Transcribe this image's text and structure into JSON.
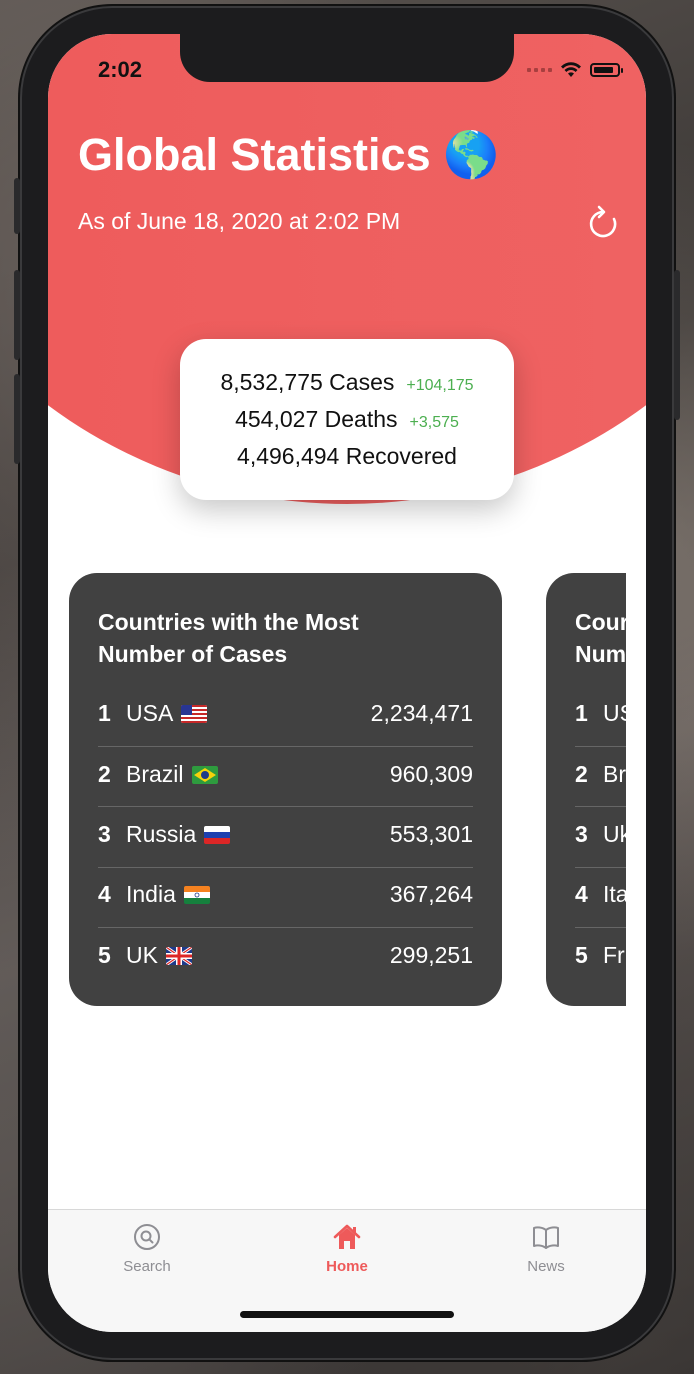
{
  "status_bar": {
    "time": "2:02"
  },
  "header": {
    "title": "Global Statistics 🌎",
    "subtitle": "As of June 18, 2020 at 2:02 PM",
    "refresh_icon": "refresh-icon"
  },
  "totals": {
    "cases": "8,532,775 Cases",
    "cases_delta": "+104,175",
    "deaths": "454,027 Deaths",
    "deaths_delta": "+3,575",
    "recovered": "4,496,494 Recovered"
  },
  "cards": [
    {
      "title": "Countries with the Most Number of Cases",
      "rows": [
        {
          "rank": "1",
          "country": "USA",
          "count": "2,234,471"
        },
        {
          "rank": "2",
          "country": "Brazil",
          "count": "960,309"
        },
        {
          "rank": "3",
          "country": "Russia",
          "count": "553,301"
        },
        {
          "rank": "4",
          "country": "India",
          "count": "367,264"
        },
        {
          "rank": "5",
          "country": "UK",
          "count": "299,251"
        }
      ]
    },
    {
      "title_partial": "Cour",
      "title_partial_2": "Num",
      "rows": [
        {
          "rank": "1",
          "country": "US"
        },
        {
          "rank": "2",
          "country": "Br"
        },
        {
          "rank": "3",
          "country": "Uk"
        },
        {
          "rank": "4",
          "country": "Ita"
        },
        {
          "rank": "5",
          "country": "Fr"
        }
      ]
    }
  ],
  "tabs": [
    {
      "label": "Search",
      "icon": "search-icon",
      "active": false
    },
    {
      "label": "Home",
      "icon": "home-icon",
      "active": true
    },
    {
      "label": "News",
      "icon": "book-icon",
      "active": false
    }
  ],
  "colors": {
    "accent": "#ee5a5a",
    "card": "#414141",
    "delta_green": "#4caf50",
    "tab_inactive": "#8e8e93"
  }
}
